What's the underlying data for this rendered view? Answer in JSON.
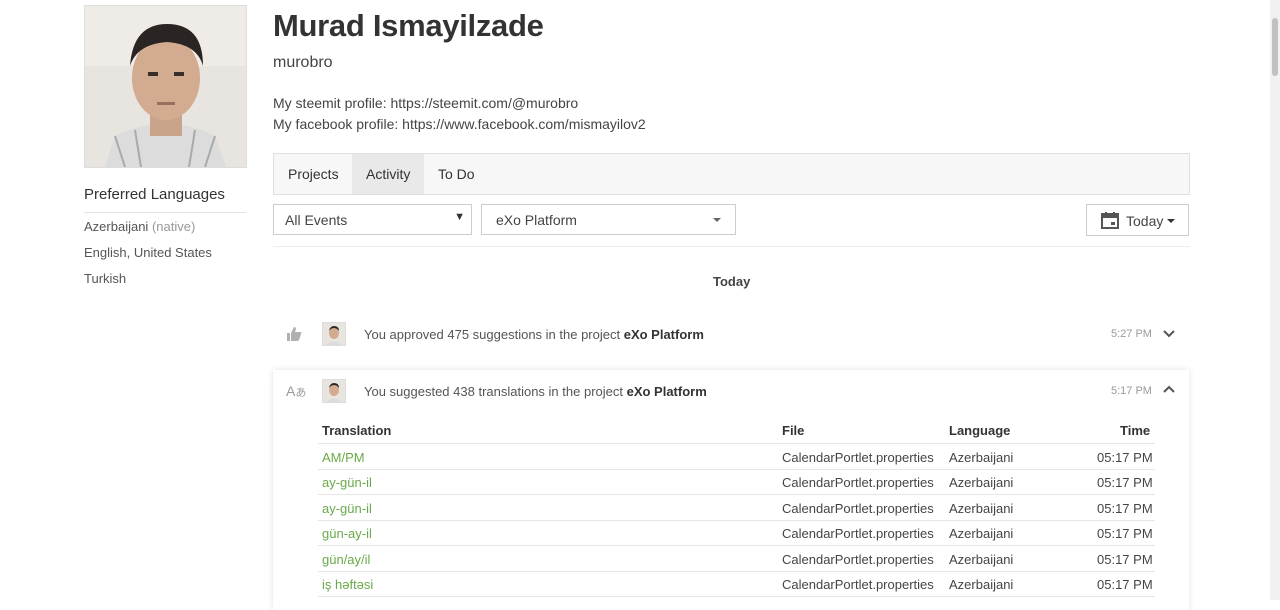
{
  "profile": {
    "name": "Murad Ismayilzade",
    "username": "murobro",
    "bio": [
      "My steemit profile: https://steemit.com/@murobro",
      "My facebook profile: https://www.facebook.com/mismayilov2"
    ],
    "preferred_languages_title": "Preferred Languages",
    "languages": [
      {
        "name": "Azerbaijani",
        "note": "(native)"
      },
      {
        "name": "English, United States",
        "note": ""
      },
      {
        "name": "Turkish",
        "note": ""
      }
    ]
  },
  "tabs": [
    {
      "label": "Projects",
      "active": false
    },
    {
      "label": "Activity",
      "active": true
    },
    {
      "label": "To Do",
      "active": false
    }
  ],
  "filters": {
    "events": "All Events",
    "project": "eXo Platform",
    "date": "Today"
  },
  "timeline": {
    "heading": "Today",
    "events": [
      {
        "icon": "thumbs-up-icon",
        "text": "You approved 475 suggestions in the project ",
        "project": "eXo Platform",
        "time": "5:27 PM",
        "expanded": false
      },
      {
        "icon": "translate-icon",
        "text": "You suggested 438 translations in the project ",
        "project": "eXo Platform",
        "time": "5:17 PM",
        "expanded": true
      }
    ]
  },
  "table": {
    "headers": [
      "Translation",
      "File",
      "Language",
      "Time"
    ],
    "rows": [
      {
        "translation": "AM/PM",
        "file": "CalendarPortlet.properties",
        "language": "Azerbaijani",
        "time": "05:17 PM"
      },
      {
        "translation": "ay-gün-il",
        "file": "CalendarPortlet.properties",
        "language": "Azerbaijani",
        "time": "05:17 PM"
      },
      {
        "translation": "ay-gün-il",
        "file": "CalendarPortlet.properties",
        "language": "Azerbaijani",
        "time": "05:17 PM"
      },
      {
        "translation": "gün-ay-il",
        "file": "CalendarPortlet.properties",
        "language": "Azerbaijani",
        "time": "05:17 PM"
      },
      {
        "translation": "gün/ay/il",
        "file": "CalendarPortlet.properties",
        "language": "Azerbaijani",
        "time": "05:17 PM"
      },
      {
        "translation": "iş həftəsi",
        "file": "CalendarPortlet.properties",
        "language": "Azerbaijani",
        "time": "05:17 PM"
      }
    ]
  },
  "colors": {
    "translation_link": "#6aa94a",
    "tab_active": "#e9e9e9",
    "tab_bar": "#f7f7f7"
  }
}
